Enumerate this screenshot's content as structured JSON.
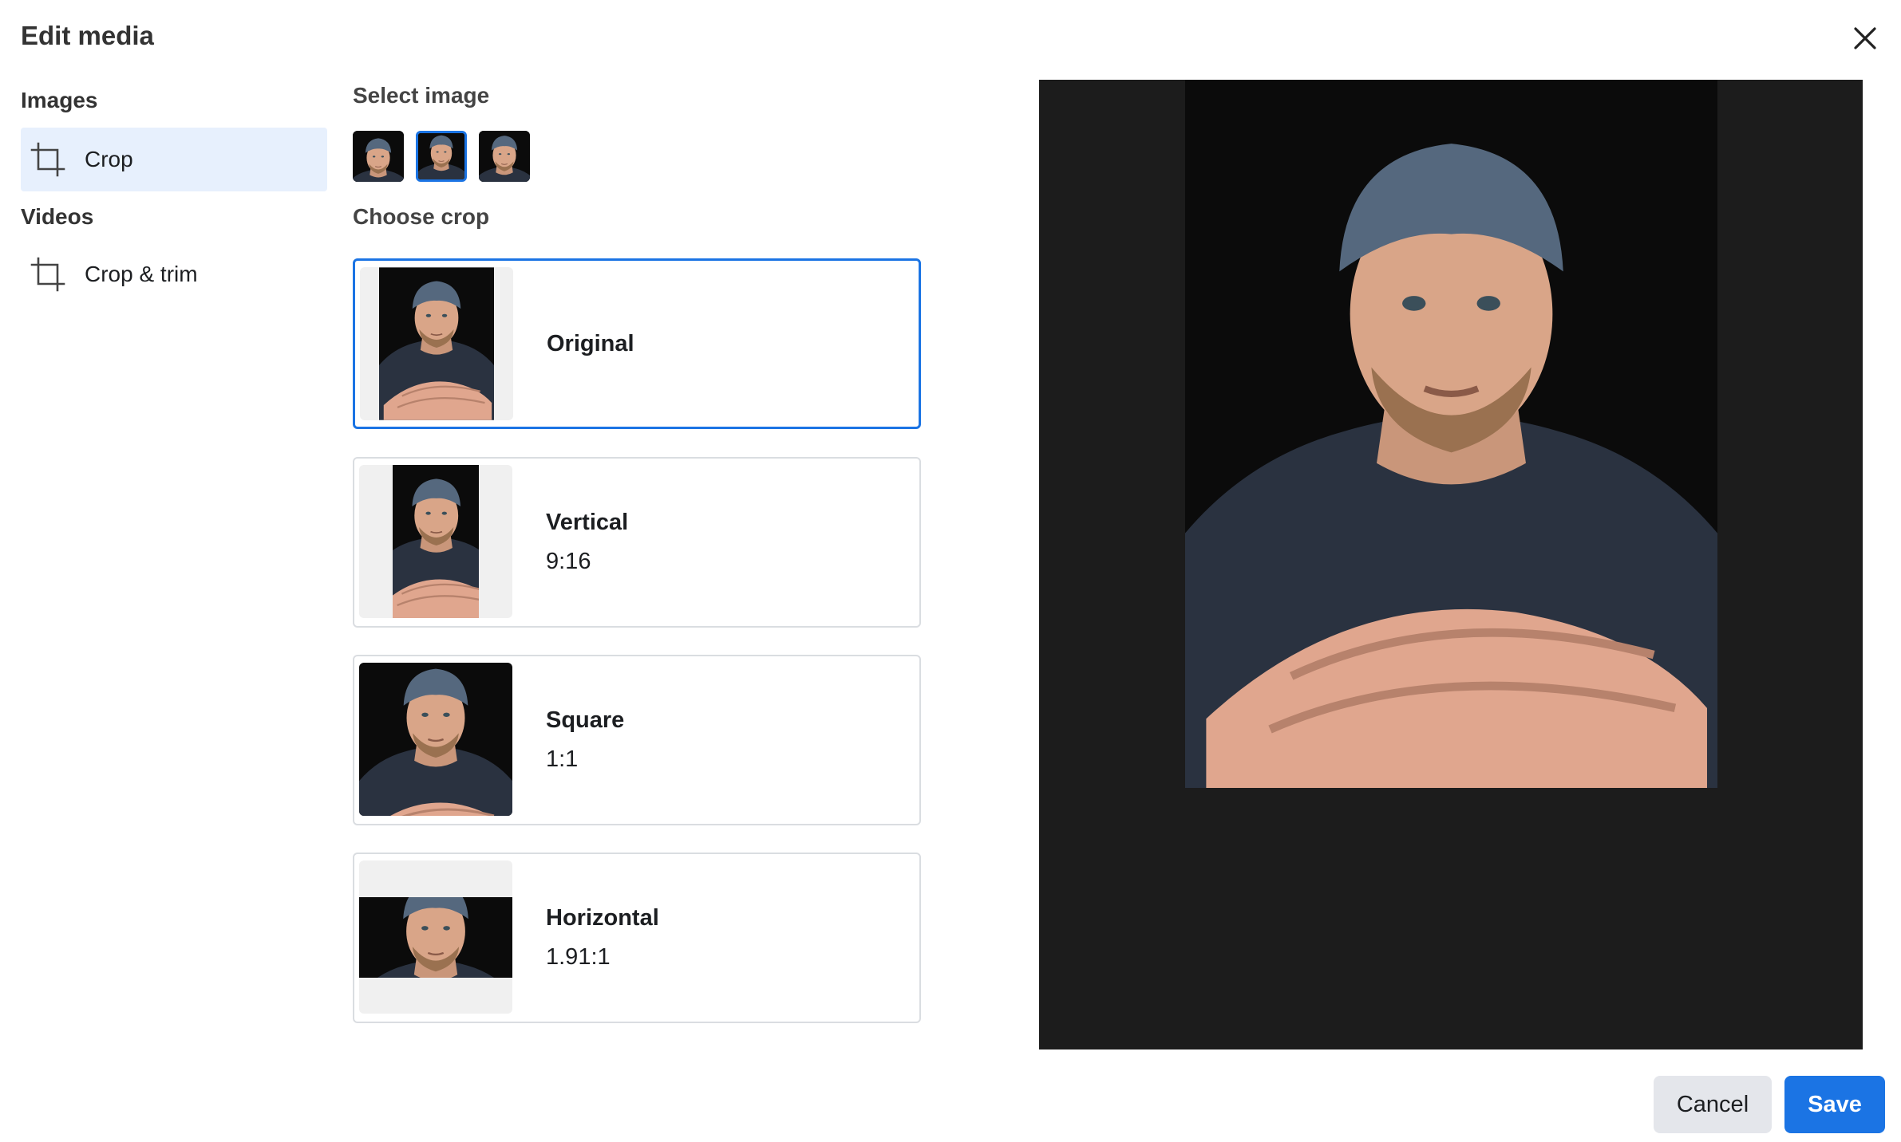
{
  "dialog": {
    "title": "Edit media"
  },
  "nav": {
    "images_heading": "Images",
    "videos_heading": "Videos",
    "items": [
      {
        "label": "Crop",
        "icon": "crop-icon",
        "active": true
      },
      {
        "label": "Crop & trim",
        "icon": "crop-icon",
        "active": false
      }
    ]
  },
  "select_image": {
    "label": "Select image",
    "thumbnails": [
      {
        "icon": "portrait-photo",
        "selected": false
      },
      {
        "icon": "portrait-photo",
        "selected": true
      },
      {
        "icon": "portrait-photo",
        "selected": false
      }
    ]
  },
  "choose_crop": {
    "label": "Choose crop",
    "options": [
      {
        "name": "Original",
        "ratio": "",
        "selected": true
      },
      {
        "name": "Vertical",
        "ratio": "9:16",
        "selected": false
      },
      {
        "name": "Square",
        "ratio": "1:1",
        "selected": false
      },
      {
        "name": "Horizontal",
        "ratio": "1.91:1",
        "selected": false
      }
    ]
  },
  "footer": {
    "cancel_label": "Cancel",
    "save_label": "Save"
  },
  "colors": {
    "accent": "#1b74e4",
    "active_nav_bg": "#e7f0fd",
    "preview_bg": "#1c1c1c"
  }
}
